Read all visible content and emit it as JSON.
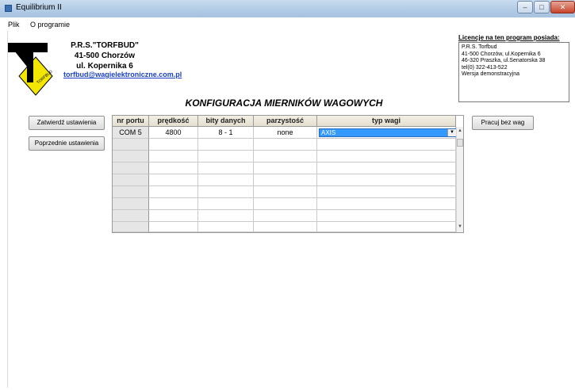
{
  "window": {
    "title": "Equilibrium II"
  },
  "menu": [
    {
      "label": "Plik"
    },
    {
      "label": "O programie"
    }
  ],
  "company": {
    "logo_text": "TORFBUD",
    "name": "P.R.S.\"TORFBUD\"",
    "city": "41-500 Chorzów",
    "street": "ul. Kopernika 6",
    "email": "torfbud@wagielektroniczne.com.pl"
  },
  "licence": {
    "title": "Licencje na ten program posiada:",
    "lines": [
      "P.R.S. Torfbud",
      "41-500 Chorzów, ul.Kopernika 6",
      "46-320 Praszka, ul.Senatorska 38",
      "tel(0) 322-413-522",
      "Wersja demonstracyjna"
    ]
  },
  "heading": "KONFIGURACJA MIERNIKÓW WAGOWYCH",
  "buttons": {
    "confirm": "Zatwierdź ustawienia",
    "previous": "Poprzednie ustawienia",
    "no_scales": "Pracuj bez wag"
  },
  "table": {
    "columns": [
      "nr portu",
      "prędkość",
      "bity danych",
      "parzystość",
      "typ wagi"
    ],
    "rows": [
      {
        "port": "COM 5",
        "speed": "4800",
        "bits": "8 - 1",
        "parity": "none",
        "type": "AXIS"
      }
    ]
  }
}
